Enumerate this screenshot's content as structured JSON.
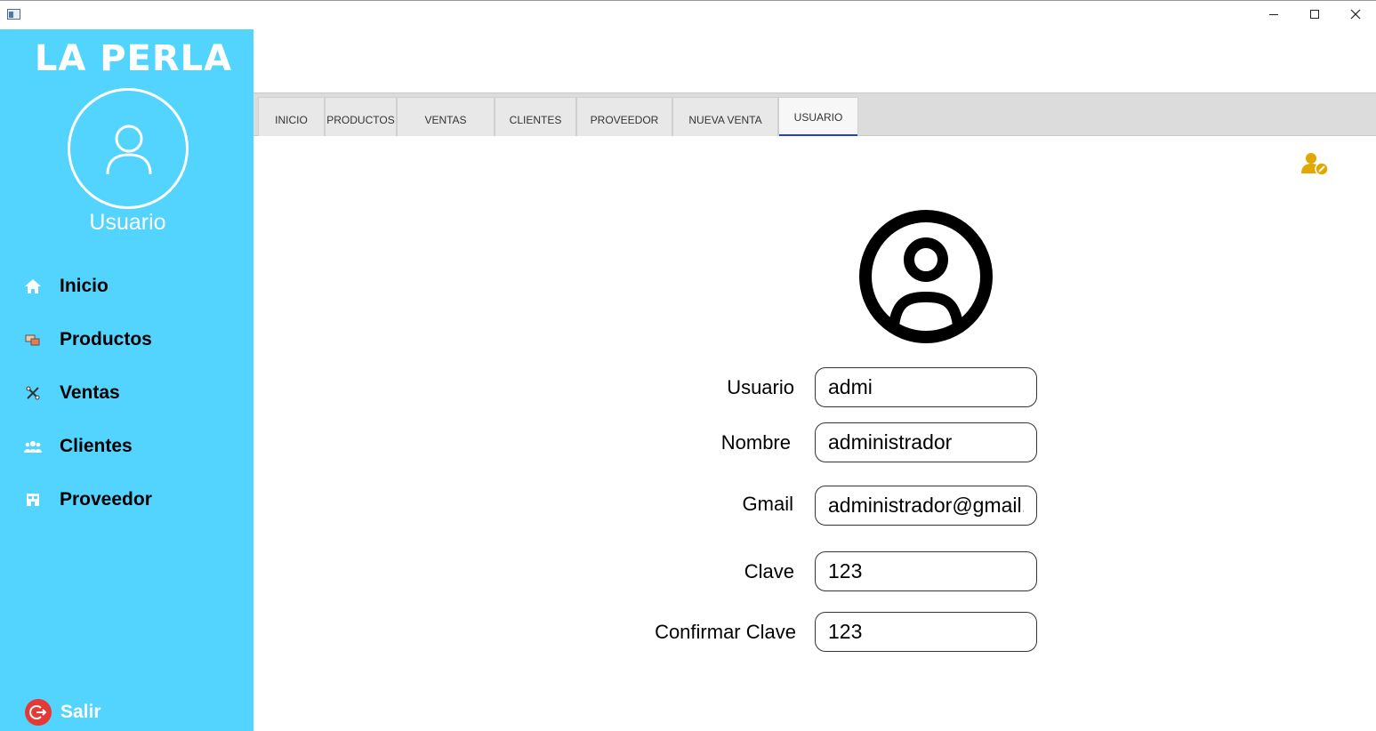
{
  "window": {
    "controls": {
      "minimize": "minimize",
      "maximize": "maximize",
      "close": "close"
    }
  },
  "sidebar": {
    "brand": "LA PERLA",
    "user_label": "Usuario",
    "items": [
      {
        "label": "Inicio",
        "icon": "home-icon"
      },
      {
        "label": "Productos",
        "icon": "products-icon"
      },
      {
        "label": "Ventas",
        "icon": "sales-icon"
      },
      {
        "label": "Clientes",
        "icon": "clients-icon"
      },
      {
        "label": "Proveedor",
        "icon": "supplier-icon"
      }
    ],
    "logout_label": "Salir",
    "background_color": "#52d4ff"
  },
  "tabs": [
    {
      "label": "INICIO"
    },
    {
      "label": "PRODUCTOS"
    },
    {
      "label": "VENTAS"
    },
    {
      "label": "CLIENTES"
    },
    {
      "label": "PROVEEDOR"
    },
    {
      "label": "NUEVA VENTA"
    },
    {
      "label": "USUARIO",
      "active": true
    }
  ],
  "form": {
    "usuario": {
      "label": "Usuario",
      "value": "admi"
    },
    "nombre": {
      "label": "Nombre",
      "value": "administrador"
    },
    "gmail": {
      "label": "Gmail",
      "value": "administrador@gmail.com"
    },
    "clave": {
      "label": "Clave",
      "value": "123"
    },
    "confirmar": {
      "label": "Confirmar Clave",
      "value": "123"
    }
  },
  "colors": {
    "accent_tab": "#2a3fbf",
    "edit_icon": "#e0a800",
    "logout": "#e53935"
  }
}
